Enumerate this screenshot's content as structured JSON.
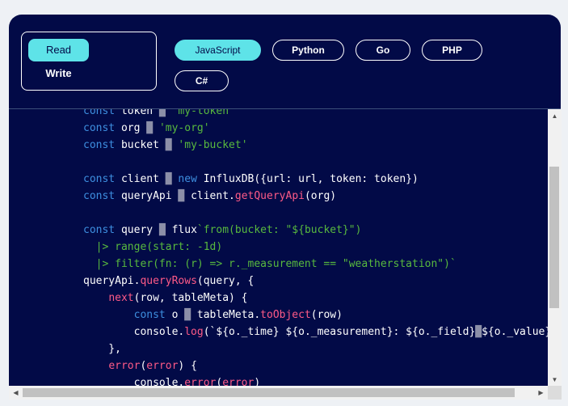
{
  "mode_toggle": {
    "read_label": "Read",
    "write_label": "Write"
  },
  "languages": [
    "JavaScript",
    "Python",
    "Go",
    "PHP",
    "C#"
  ],
  "selected_language": "JavaScript",
  "colors": {
    "panel_bg": "#020a47",
    "accent": "#5ee3e8",
    "keyword": "#3e8fe0",
    "string": "#58b93e",
    "function": "#ff5a87"
  },
  "code_lines": [
    "const token = 'my-token'",
    "const org = 'my-org'",
    "const bucket = 'my-bucket'",
    "",
    "const client = new InfluxDB({url: url, token: token})",
    "const queryApi = client.getQueryApi(org)",
    "",
    "const query = flux`from(bucket: \"${bucket}\")",
    "  |> range(start: -1d)",
    "  |> filter(fn: (r) => r._measurement == \"weatherstation\")`",
    "queryApi.queryRows(query, {",
    "    next(row, tableMeta) {",
    "        const o = tableMeta.toObject(row)",
    "        console.log(`${o._time} ${o._measurement}: ${o._field}=${o._value}`)",
    "    },",
    "    error(error) {",
    "        console.error(error)"
  ],
  "icons": [
    "scroll-up-arrow-icon",
    "scroll-down-arrow-icon",
    "scroll-left-arrow-icon",
    "scroll-right-arrow-icon"
  ]
}
